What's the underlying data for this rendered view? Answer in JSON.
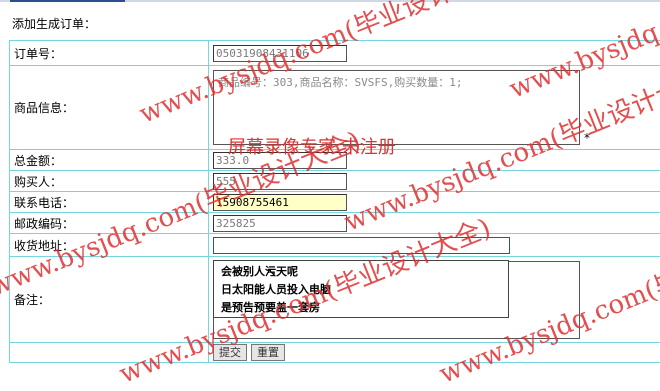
{
  "page": {
    "title": "添加生成订单："
  },
  "form": {
    "order_no": {
      "label": "订单号：",
      "value": "05031908431106"
    },
    "goods_info": {
      "label": "商品信息：",
      "value": "商品编号：303,商品名称：SVSFS,购买数量：1;"
    },
    "total": {
      "label": "总金额：",
      "value": "333.0"
    },
    "buyer": {
      "label": "购买人：",
      "value": "555"
    },
    "phone": {
      "label": "联系电话：",
      "value": "15908755461"
    },
    "postcode": {
      "label": "邮政编码：",
      "value": "325825"
    },
    "address": {
      "label": "收货地址：",
      "value": ""
    },
    "remark": {
      "label": "备注：",
      "value": ""
    },
    "required_mark": "*",
    "submit_label": "提交",
    "reset_label": "重置"
  },
  "autocomplete": {
    "items": [
      "会被别人污天呢",
      "日太阳能人员投入电脑",
      "是预告预要盖一套房"
    ]
  },
  "watermarks": {
    "site": "www.bysjdq.com(毕业设计大全)",
    "recorder": "屏幕录像专家 未注册"
  },
  "colors": {
    "border": "#75d6df",
    "watermark": "#e03030",
    "phone_bg": "#ffffc8"
  }
}
